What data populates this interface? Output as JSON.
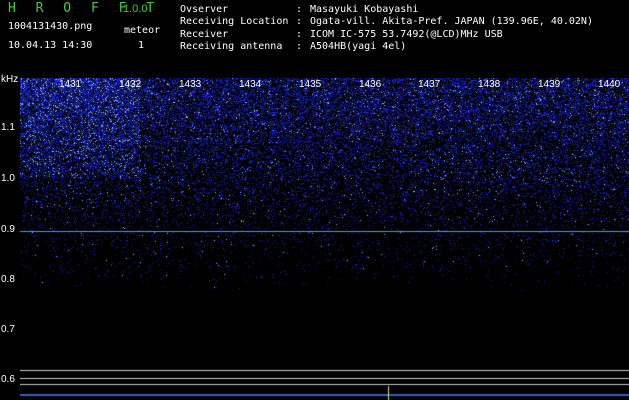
{
  "header": {
    "app_name": "H R O F F T",
    "version": "1.0.0",
    "filename": "1004131430.png",
    "datetime": "10.04.13 14:30",
    "meteor_label": "meteor",
    "meteor_count": "1"
  },
  "info": [
    {
      "key": "Ovserver",
      "value": "Masayuki Kobayashi"
    },
    {
      "key": "Receiving Location",
      "value": "Ogata-vill. Akita-Pref. JAPAN (139.96E, 40.02N)"
    },
    {
      "key": "Receiver",
      "value": "ICOM IC-575 53.7492(@LCD)MHz USB"
    },
    {
      "key": "Receiving antenna",
      "value": "A504HB(yagi 4el)"
    }
  ],
  "chart_data": {
    "type": "heatmap",
    "ylabel": "kHz",
    "x_ticks": [
      "1431",
      "1432",
      "1433",
      "1434",
      "1435",
      "1436",
      "1437",
      "1438",
      "1439",
      "1440"
    ],
    "y_ticks": [
      "1.1",
      "1.0",
      "0.9",
      "0.8",
      "0.7",
      "0.6"
    ],
    "yrange": [
      0.58,
      1.18
    ],
    "carrier_khz": 0.895,
    "colors": {
      "noise": "#2a3cff",
      "carrier": "#3aa0ff",
      "baseline": "#c8c8c8"
    }
  }
}
